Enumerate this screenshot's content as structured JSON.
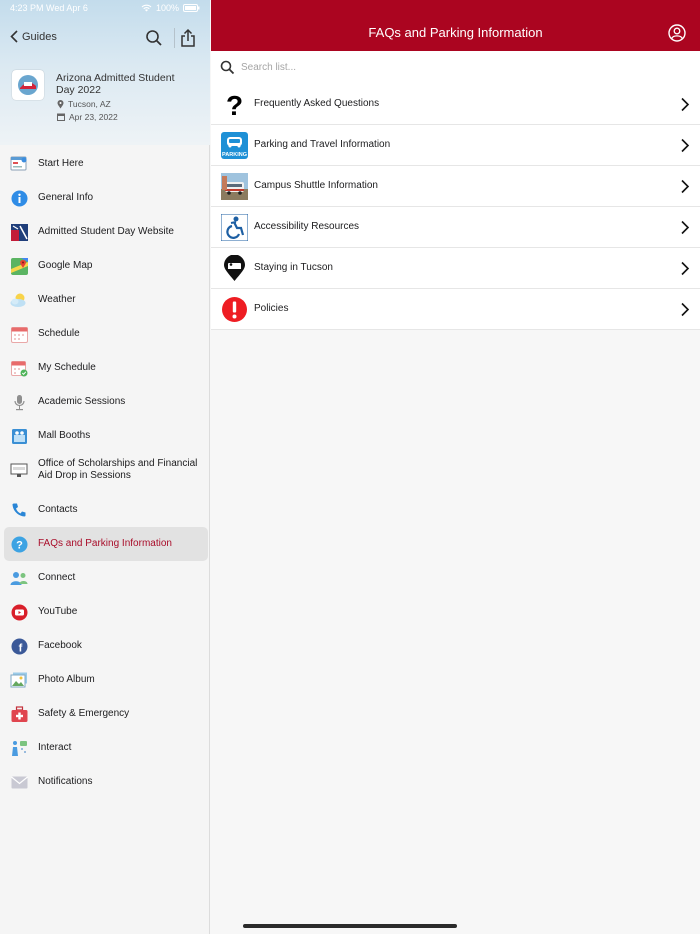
{
  "status_bar": {
    "time_date": "4:23 PM  Wed Apr 6",
    "battery": "100%"
  },
  "sidebar": {
    "back_label": "Guides",
    "guide": {
      "title": "Arizona Admitted Student Day 2022",
      "location": "Tucson, AZ",
      "date": "Apr 23, 2022"
    },
    "items": [
      {
        "label": "Start Here",
        "icon": "start-here-icon"
      },
      {
        "label": "General Info",
        "icon": "info-icon"
      },
      {
        "label": "Admitted Student Day Website",
        "icon": "website-icon"
      },
      {
        "label": "Google Map",
        "icon": "map-icon"
      },
      {
        "label": "Weather",
        "icon": "weather-icon"
      },
      {
        "label": "Schedule",
        "icon": "calendar-icon"
      },
      {
        "label": "My Schedule",
        "icon": "my-schedule-icon"
      },
      {
        "label": "Academic Sessions",
        "icon": "microphone-icon"
      },
      {
        "label": "Mall Booths",
        "icon": "booth-icon"
      },
      {
        "label": "Office of Scholarships and Financial Aid Drop in Sessions",
        "icon": "scholarship-icon"
      },
      {
        "label": "Contacts",
        "icon": "phone-icon"
      },
      {
        "label": "FAQs and Parking Information",
        "icon": "question-icon"
      },
      {
        "label": "Connect",
        "icon": "people-icon"
      },
      {
        "label": "YouTube",
        "icon": "youtube-icon"
      },
      {
        "label": "Facebook",
        "icon": "facebook-icon"
      },
      {
        "label": "Photo Album",
        "icon": "photo-icon"
      },
      {
        "label": "Safety & Emergency",
        "icon": "first-aid-icon"
      },
      {
        "label": "Interact",
        "icon": "interact-icon"
      },
      {
        "label": "Notifications",
        "icon": "envelope-icon"
      }
    ],
    "active_index": 11
  },
  "main": {
    "title": "FAQs and Parking Information",
    "search_placeholder": "Search list...",
    "rows": [
      {
        "label": "Frequently Asked Questions",
        "icon": "question-mark-icon"
      },
      {
        "label": "Parking and Travel Information",
        "icon": "parking-icon",
        "icon_text": "PARKING"
      },
      {
        "label": "Campus Shuttle Information",
        "icon": "shuttle-photo-icon"
      },
      {
        "label": "Accessibility Resources",
        "icon": "accessibility-icon"
      },
      {
        "label": "Staying in Tucson",
        "icon": "hotel-pin-icon"
      },
      {
        "label": "Policies",
        "icon": "alert-icon"
      }
    ]
  },
  "colors": {
    "accent": "#ab0520",
    "active_text": "#a90d2a",
    "active_bg": "#e2e2e2"
  }
}
